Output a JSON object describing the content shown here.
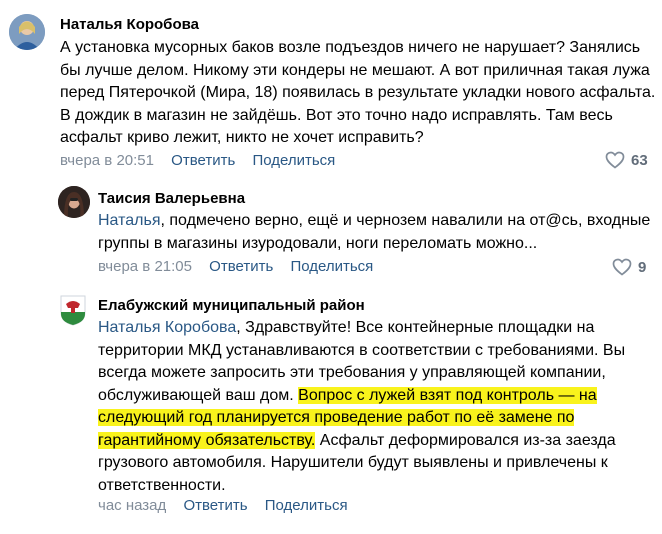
{
  "comments": [
    {
      "author": "Наталья Коробова",
      "text": "А установка мусорных баков возле подъездов ничего не нарушает? Занялись бы лучше делом. Никому эти кондеры не мешают. А вот приличная такая лужа перед Пятерочкой (Мира, 18) появилась в результате укладки нового асфальта. В дождик в магазин не зайдёшь. Вот это точно надо исправлять. Там весь асфальт криво лежит, никто не хочет исправить?",
      "time": "вчера в 20:51",
      "reply_label": "Ответить",
      "share_label": "Поделиться",
      "likes": "63",
      "like_icon": "heart-icon"
    },
    {
      "author": "Таисия Валерьевна",
      "mention": "Наталья",
      "text": ", подмечено верно, ещё и чернозем навалили на от@сь, входные группы в магазины изуродовали, ноги переломать можно...",
      "time": "вчера в 21:05",
      "reply_label": "Ответить",
      "share_label": "Поделиться",
      "likes": "9",
      "like_icon": "heart-icon"
    },
    {
      "author": "Елабужский муниципальный район",
      "mention": "Наталья Коробова",
      "text_before": ", Здравствуйте! Все контейнерные площадки на территории МКД устанавливаются в соответствии с требованиями. Вы всегда можете запросить эти требования у управляющей компании, обслуживающей ваш дом. ",
      "text_highlighted": "Вопрос с лужей взят под контроль — на следующий год планируется проведение работ по её замене по гарантийному обязательству.",
      "text_after": " Асфальт деформировался из-за заезда грузового автомобиля. Нарушители будут выявлены и привлечены к ответственности.",
      "time": "час назад",
      "reply_label": "Ответить",
      "share_label": "Поделиться"
    }
  ],
  "colors": {
    "link": "#2a5885",
    "meta": "#818c99",
    "highlight": "#f9f31c"
  }
}
